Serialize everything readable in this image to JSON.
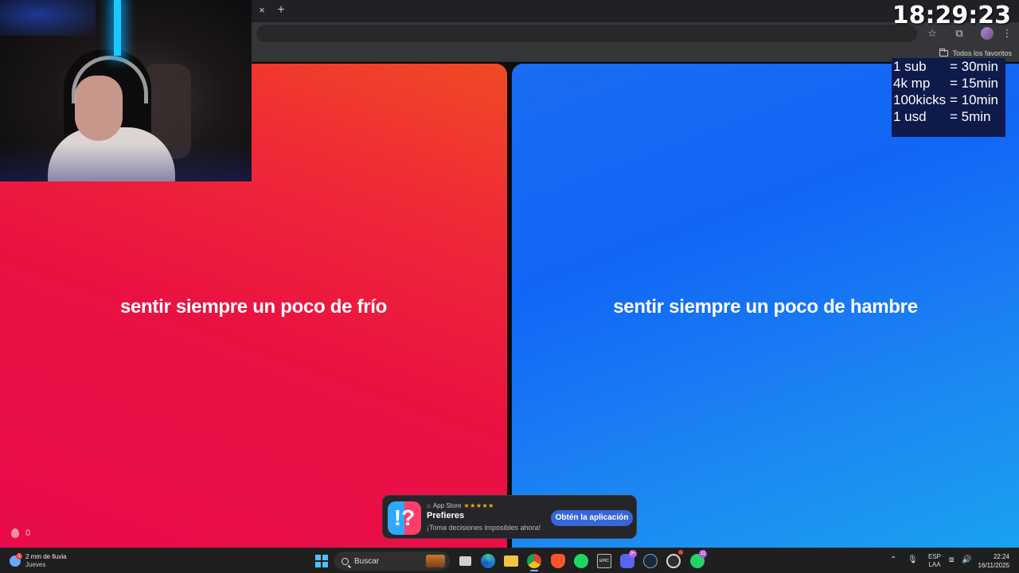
{
  "browser": {
    "tab_close": "×",
    "new_tab": "+",
    "window_close": "✕",
    "bookmarks_folder": "Todos los favoritos"
  },
  "options": {
    "left": {
      "text": "sentir siempre un poco de frío",
      "color": "#ea1142"
    },
    "right": {
      "text": "sentir siempre un poco de hambre",
      "color": "#1166f6"
    }
  },
  "likes_count": "0",
  "stream_overlay": {
    "timer": "18:29:23",
    "rates": [
      {
        "key": "1 sub",
        "value": "= 30min"
      },
      {
        "key": "4k mp",
        "value": "= 15min"
      },
      {
        "key": "100kicks",
        "value": "= 10min"
      },
      {
        "key": "1 usd",
        "value": "=  5min"
      }
    ]
  },
  "app_banner": {
    "store": "App Store",
    "stars": "★★★★★",
    "title": "Prefieres",
    "subtitle": "¡Toma decisiones imposibles ahora!",
    "button": "Obtén la aplicación"
  },
  "taskbar": {
    "weather_badge": "1",
    "weather_main": "2 mm de lluvia",
    "weather_sub": "Jueves",
    "search_label": "Buscar",
    "epic_label": "EPIC",
    "discord_badge": "9+",
    "whatsapp_badge": "11",
    "lang_top": "ESP",
    "lang_bottom": "LAA",
    "time": "22:24",
    "date": "16/11/2025"
  }
}
